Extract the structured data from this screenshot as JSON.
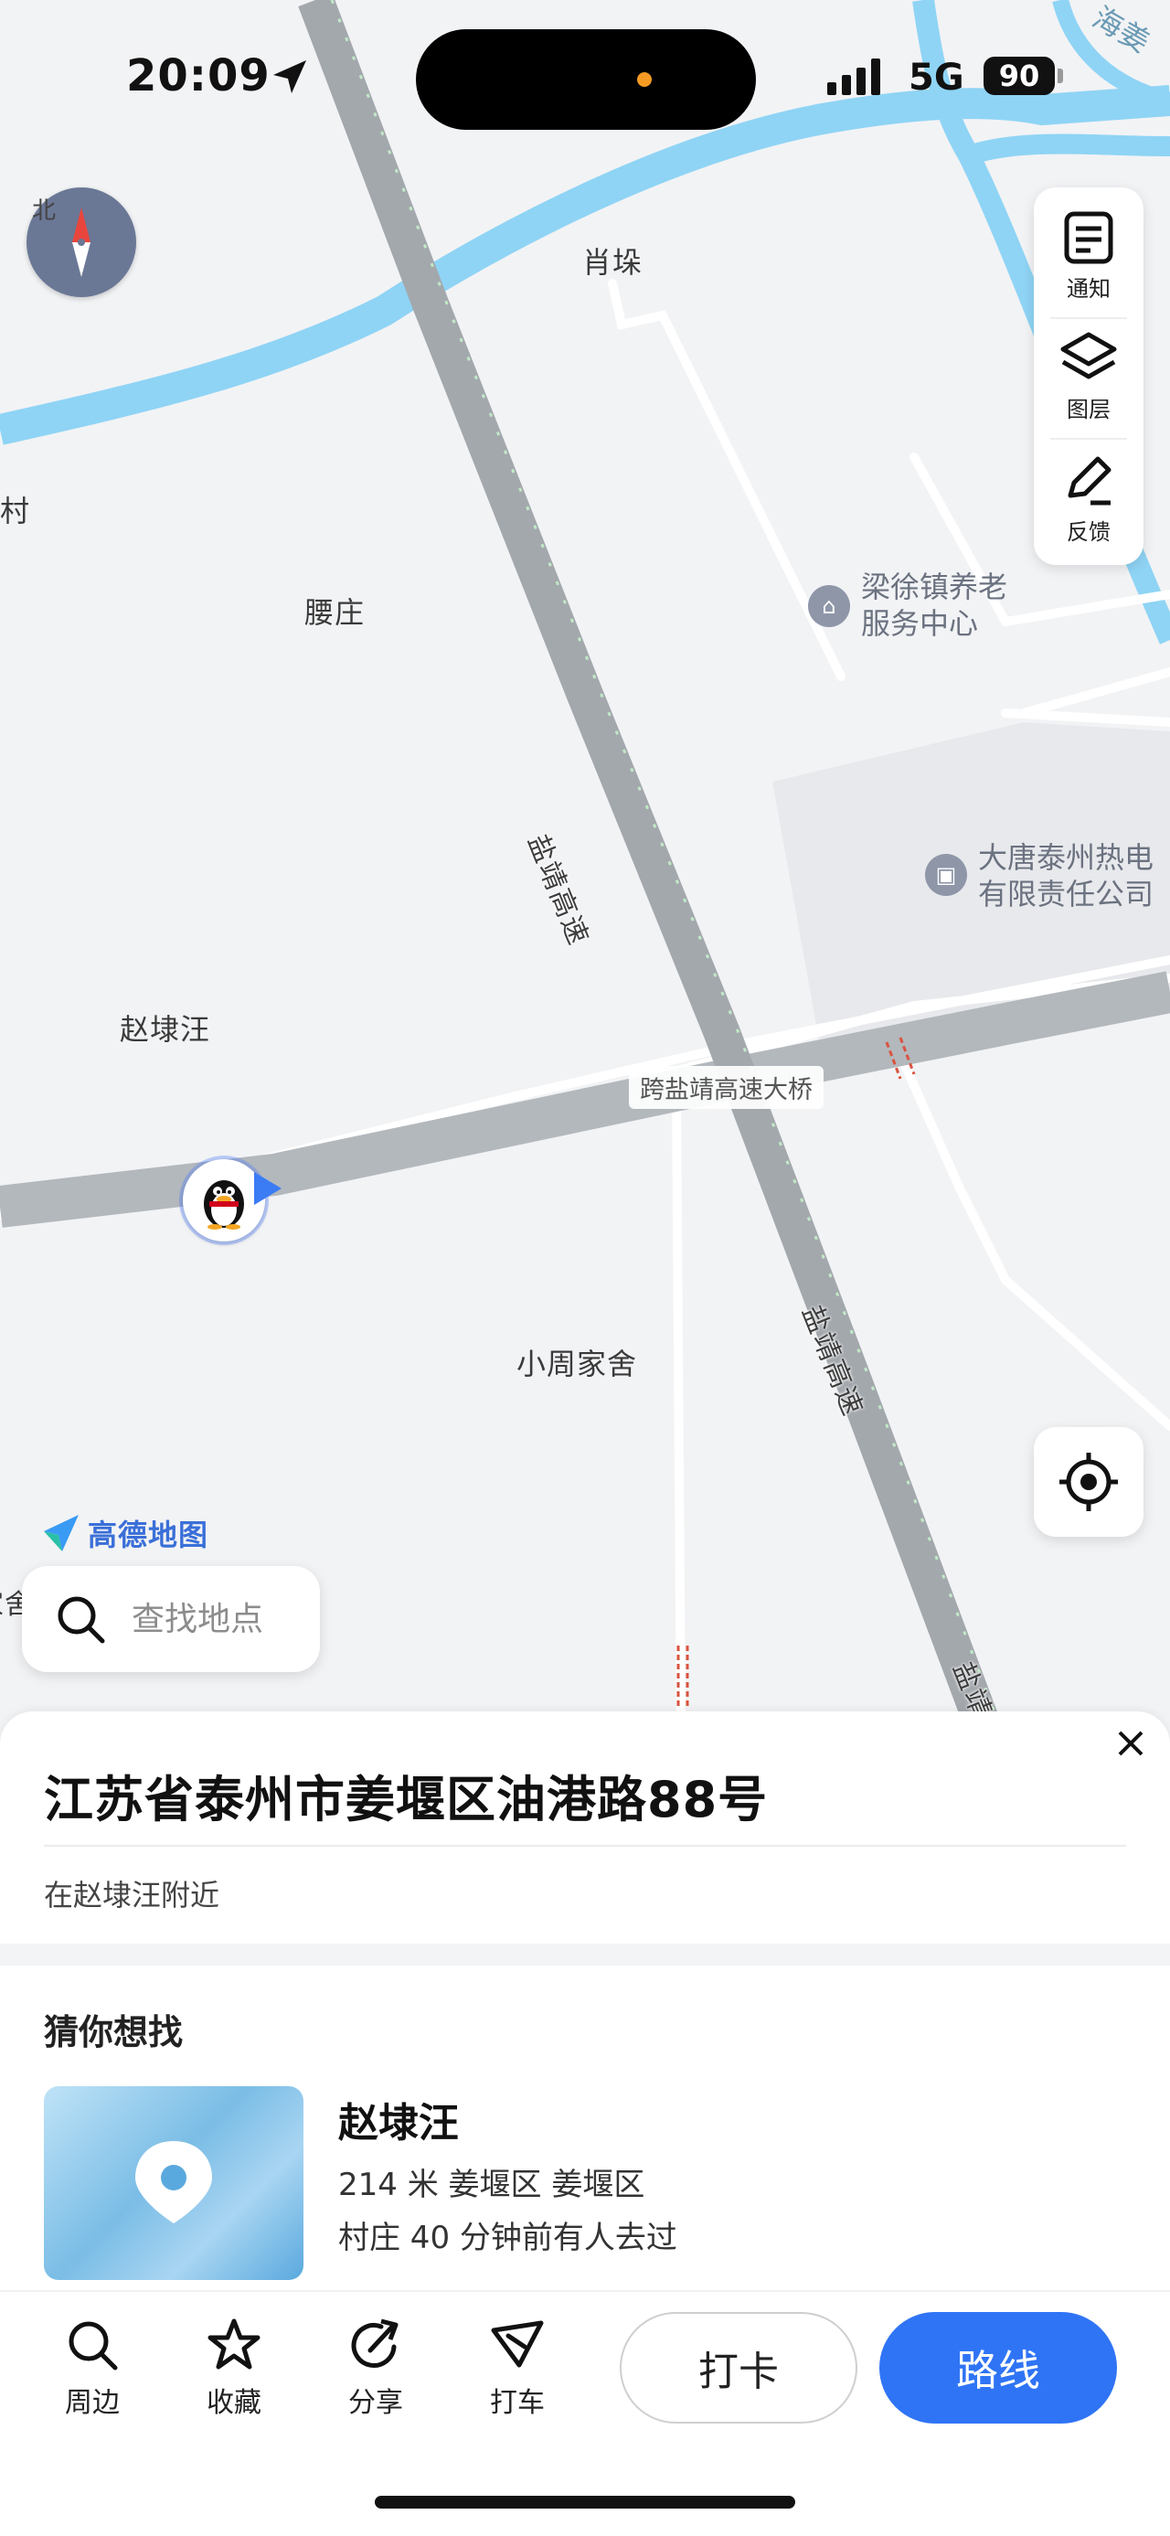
{
  "status_bar": {
    "time": "20:09",
    "network": "5G",
    "battery": "90"
  },
  "map": {
    "compass_label": "北",
    "places": {
      "xiaoduo": "肖垛",
      "yaozhuang": "腰庄",
      "zhaodaiwang": "赵埭汪",
      "xiaozhoujiashe": "小周家舍",
      "cun": "村",
      "top_right": "海姜",
      "left_edge": "家舍"
    },
    "roads": {
      "expressway": "盐靖高速",
      "bridge": "跨盐靖高速大桥"
    },
    "pois": [
      {
        "icon": "building-icon",
        "line1": "梁徐镇养老",
        "line2": "服务中心"
      },
      {
        "icon": "factory-icon",
        "line1": "大唐泰州热电",
        "line2": "有限责任公司"
      }
    ],
    "logo_text": "高德地图"
  },
  "tools": [
    {
      "label": "通知",
      "icon": "notice-icon"
    },
    {
      "label": "图层",
      "icon": "layers-icon"
    },
    {
      "label": "反馈",
      "icon": "feedback-icon"
    }
  ],
  "search": {
    "placeholder": "查找地点"
  },
  "sheet": {
    "address": "江苏省泰州市姜堰区油港路88号",
    "nearby": "在赵埭汪附近",
    "guess_title": "猜你想找",
    "place": {
      "name": "赵埭汪",
      "meta": "214 米  姜堰区  姜堰区",
      "extra": "村庄  40 分钟前有人去过"
    }
  },
  "actions": [
    {
      "label": "周边",
      "icon": "search-icon"
    },
    {
      "label": "收藏",
      "icon": "star-icon"
    },
    {
      "label": "分享",
      "icon": "share-icon"
    },
    {
      "label": "打车",
      "icon": "taxi-icon"
    }
  ],
  "buttons": {
    "checkin": "打卡",
    "route": "路线"
  },
  "colors": {
    "accent": "#2f74f5",
    "water": "#8fd4f5",
    "expressway": "#a3a8ad"
  }
}
